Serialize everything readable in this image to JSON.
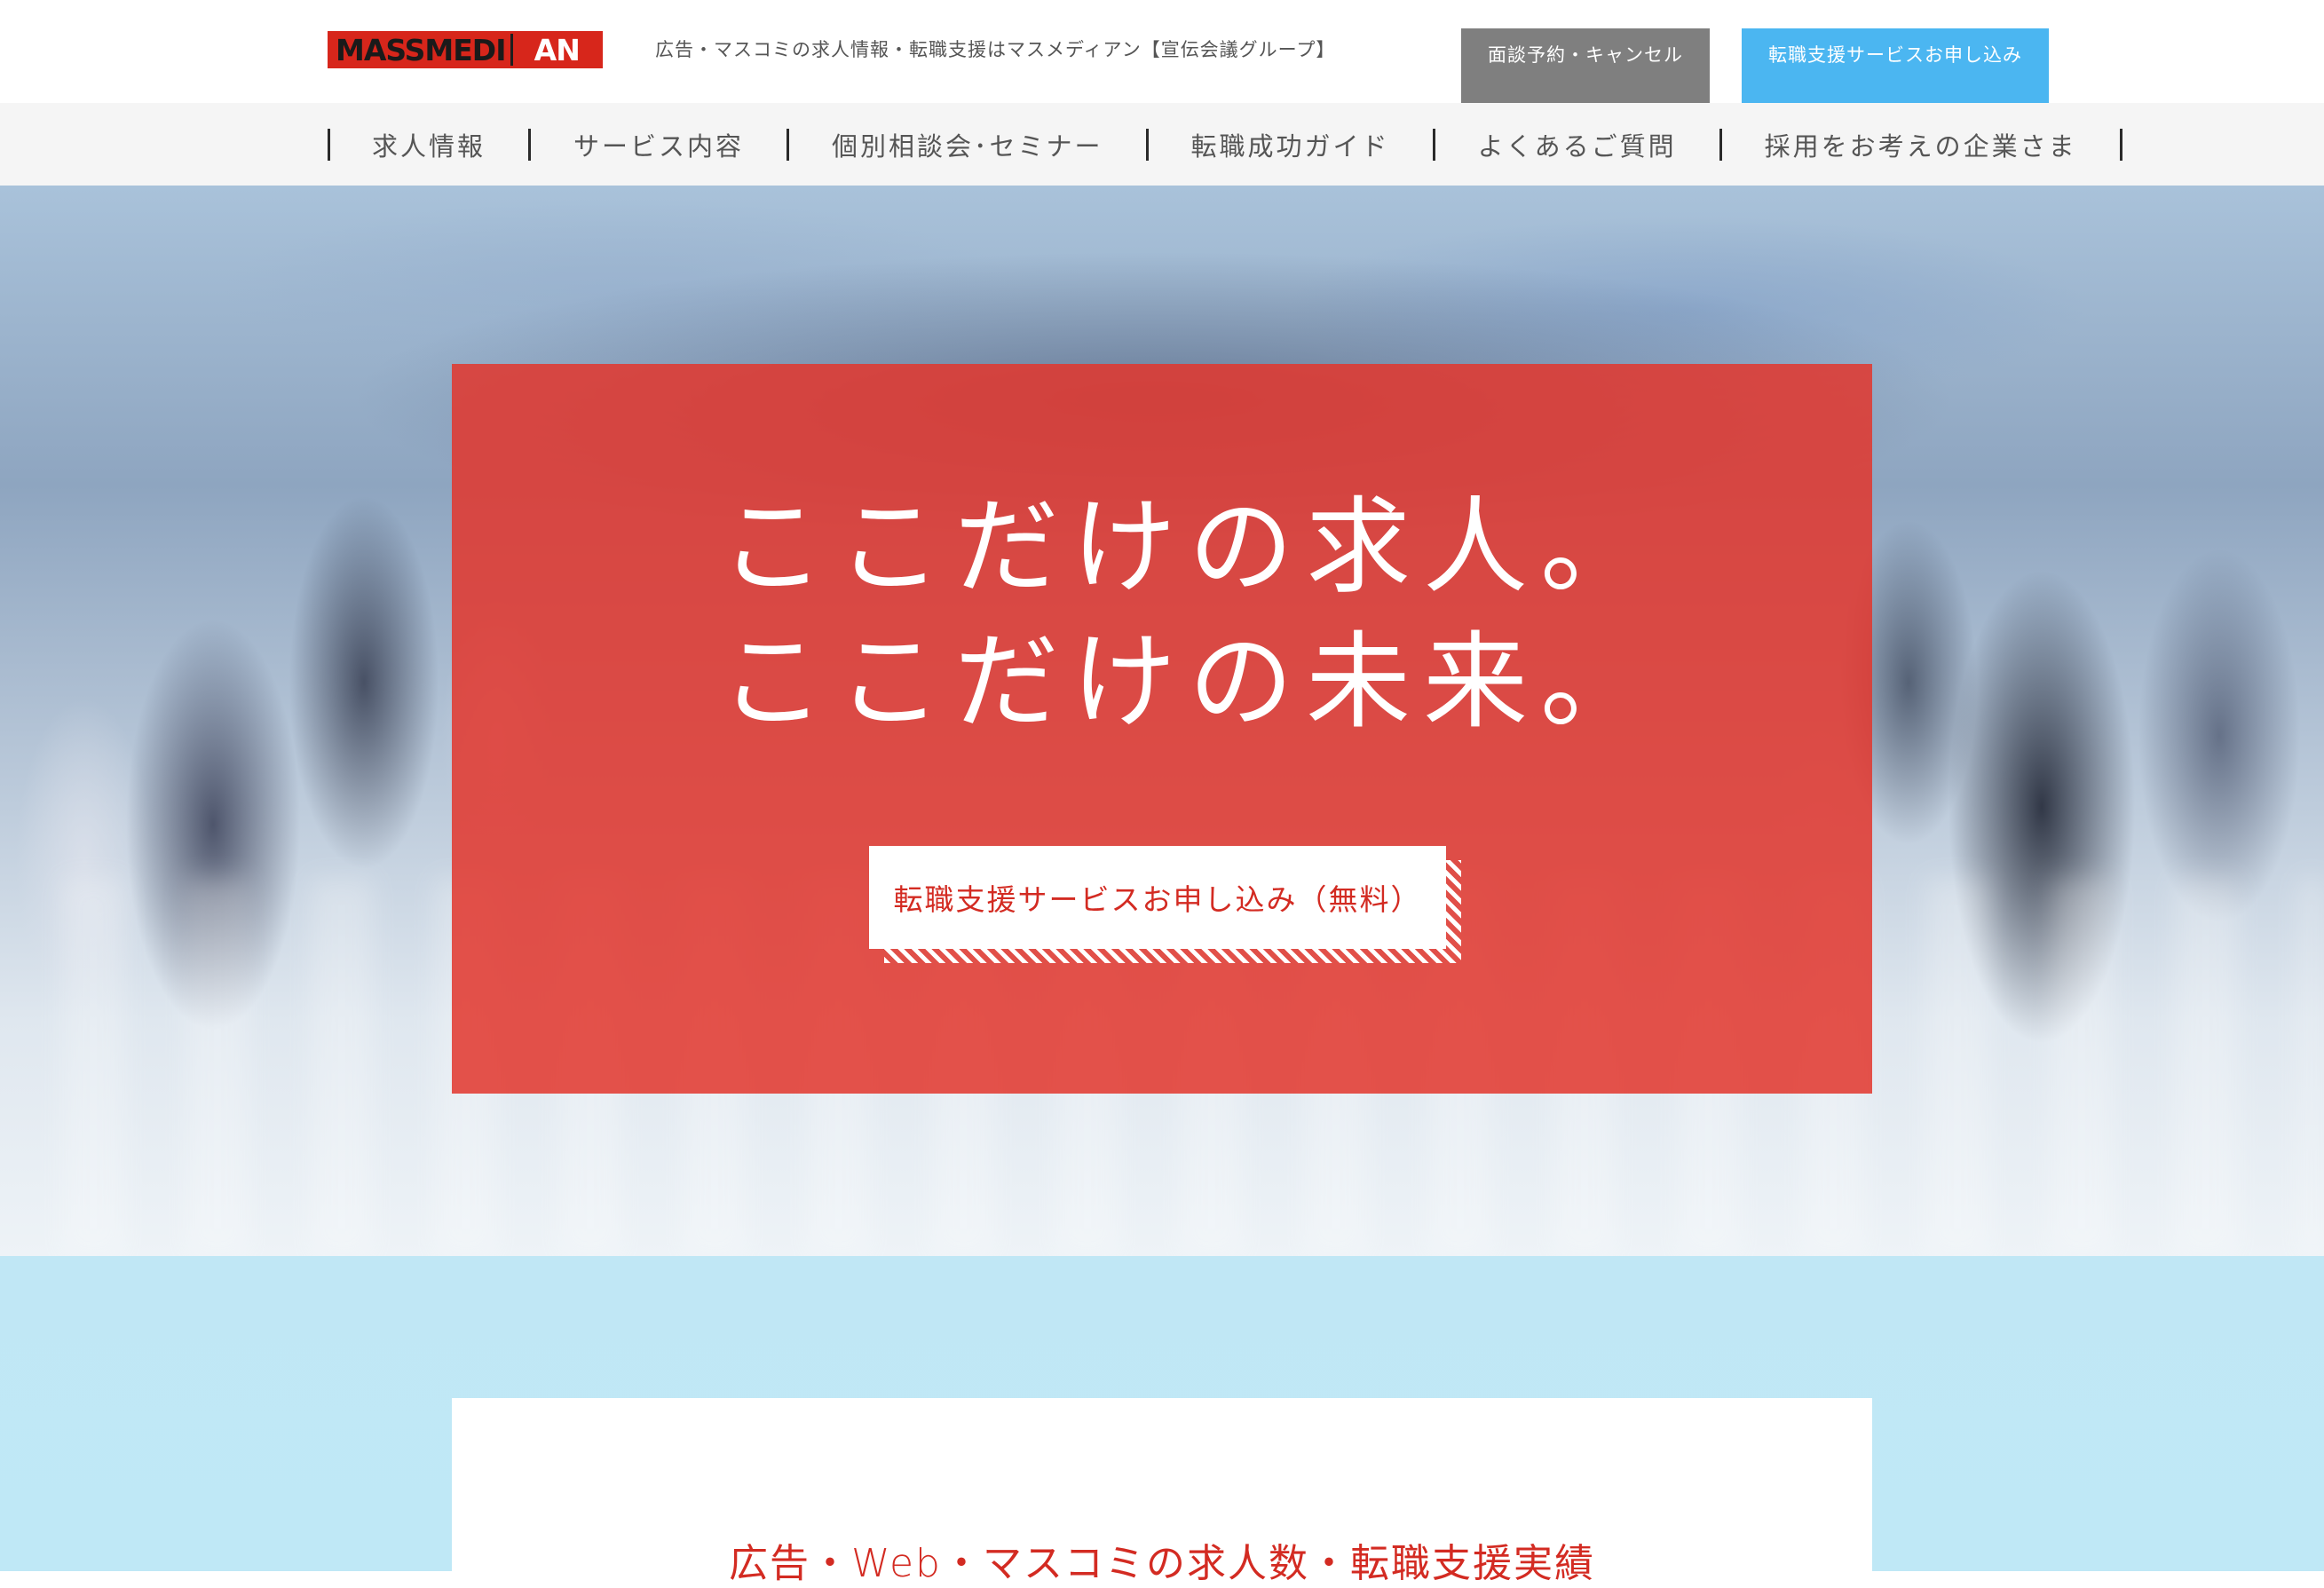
{
  "header": {
    "logo_main": "MASSMEDI",
    "logo_accent": "AN",
    "tagline": "広告・マスコミの求人情報・転職支援はマスメディアン【宣伝会議グループ】",
    "interview_button": "面談予約・キャンセル",
    "apply_button": "転職支援サービスお申し込み"
  },
  "nav": {
    "items": [
      {
        "label": "求人情報"
      },
      {
        "label": "サービス内容"
      },
      {
        "label": "個別相談会･セミナー"
      },
      {
        "label": "転職成功ガイド"
      },
      {
        "label": "よくあるご質問"
      },
      {
        "label": "採用をお考えの企業さま"
      }
    ]
  },
  "hero": {
    "line1": "ここだけの求人。",
    "line2": "ここだけの未来。",
    "cta": "転職支援サービスお申し込み（無料）"
  },
  "section": {
    "title": "広告・Web・マスコミの求人数・転職支援実績"
  },
  "colors": {
    "brand_red": "#e2372d",
    "accent_blue": "#4bb6f1",
    "gray_button": "#7f7f7f",
    "light_blue_bg": "#c0e7f5"
  }
}
